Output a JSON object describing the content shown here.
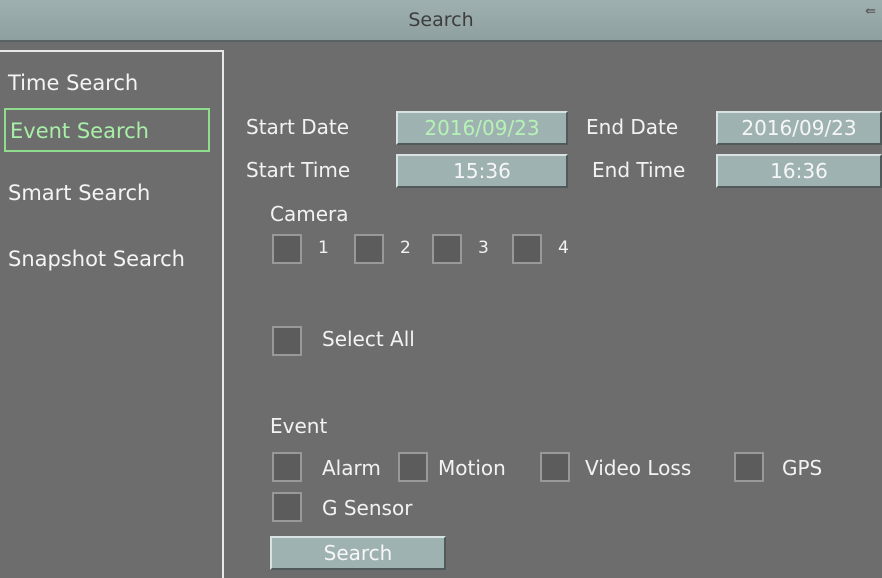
{
  "window": {
    "title": "Search"
  },
  "sidebar": {
    "items": [
      {
        "label": "Time Search"
      },
      {
        "label": "Event Search",
        "active": true
      },
      {
        "label": "Smart Search"
      },
      {
        "label": "Snapshot Search"
      }
    ]
  },
  "form": {
    "start_date_label": "Start Date",
    "start_date": "2016/09/23",
    "end_date_label": "End Date",
    "end_date": "2016/09/23",
    "start_time_label": "Start Time",
    "start_time": "15:36",
    "end_time_label": "End Time",
    "end_time": "16:36",
    "camera_label": "Camera",
    "cameras": [
      "1",
      "2",
      "3",
      "4"
    ],
    "select_all_label": "Select All",
    "event_label": "Event",
    "events": [
      "Alarm",
      "Motion",
      "Video Loss",
      "GPS",
      "G Sensor"
    ],
    "search_button": "Search"
  },
  "colors": {
    "active_accent": "#8fdc8f",
    "field_bg": "#9fb2b2",
    "panel_bg": "#6d6d6d"
  }
}
